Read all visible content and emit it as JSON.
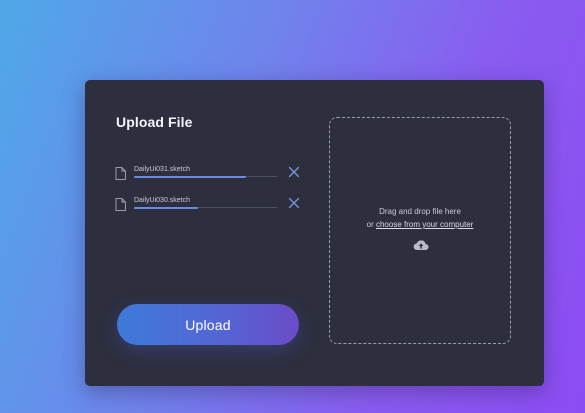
{
  "card": {
    "title": "Upload File"
  },
  "files": [
    {
      "name": "DailyUi031.sketch",
      "progress": 0.78
    },
    {
      "name": "DailyUi030.sketch",
      "progress": 0.45
    }
  ],
  "upload_button": {
    "label": "Upload"
  },
  "dropzone": {
    "instruction": "Drag and drop file here",
    "or_text": "or ",
    "choose_link": "choose from your computer"
  },
  "icons": {
    "file": "file-icon",
    "remove": "close-icon",
    "cloud": "cloud-upload-icon"
  },
  "colors": {
    "background_start": "#4fa8e8",
    "background_end": "#8c4cf3",
    "card": "#2d2e3e",
    "progress_fill": "#6b8ae3",
    "button_start": "#3e7ad8",
    "button_end": "#6a4cc8"
  }
}
